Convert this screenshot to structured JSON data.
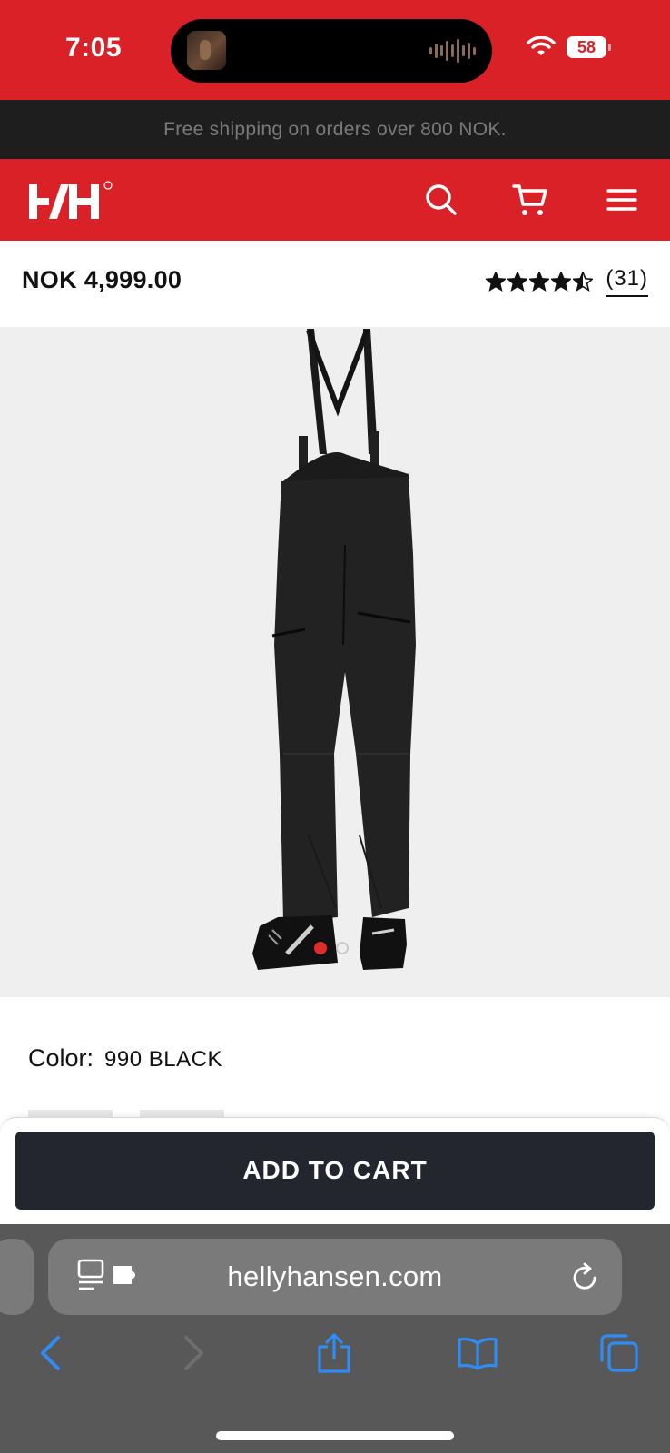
{
  "status_bar": {
    "time": "7:05",
    "battery": "58"
  },
  "promo": {
    "text": "Free shipping on orders over 800 NOK."
  },
  "header": {
    "logo_icon": "hh-logo-icon",
    "icons": [
      "search-icon",
      "cart-icon",
      "hamburger-menu-icon"
    ],
    "brand_color": "#d92127"
  },
  "product": {
    "price": "NOK 4,999.00",
    "rating": 4.5,
    "review_count": "(31)",
    "image_count": 2,
    "active_image": 1,
    "color_label": "Color:",
    "color_value": "990 BLACK"
  },
  "cart": {
    "add_to_cart_label": "ADD TO CART",
    "button_color": "#23252f"
  },
  "browser": {
    "url": "hellyhansen.com",
    "toolbar_icons": [
      "back-icon",
      "forward-icon",
      "share-icon",
      "bookmarks-icon",
      "tabs-icon"
    ],
    "accent_color": "#2f8cf5"
  }
}
